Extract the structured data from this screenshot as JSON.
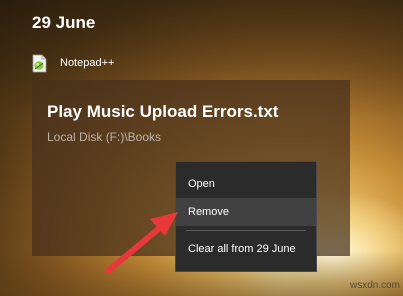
{
  "jump_list": {
    "date_header": "29 June",
    "app": {
      "name": "Notepad++",
      "icon": "notepad-plus-plus-icon"
    },
    "file": {
      "title": "Play Music Upload Errors.txt",
      "path": "Local Disk (F:)\\Books"
    }
  },
  "context_menu": {
    "items": [
      {
        "label": "Open"
      },
      {
        "label": "Remove",
        "highlighted": true
      },
      {
        "label": "Clear all from 29 June"
      }
    ]
  },
  "annotation": {
    "arrow_color": "#e8383b"
  },
  "watermark": "wsxdn.com"
}
